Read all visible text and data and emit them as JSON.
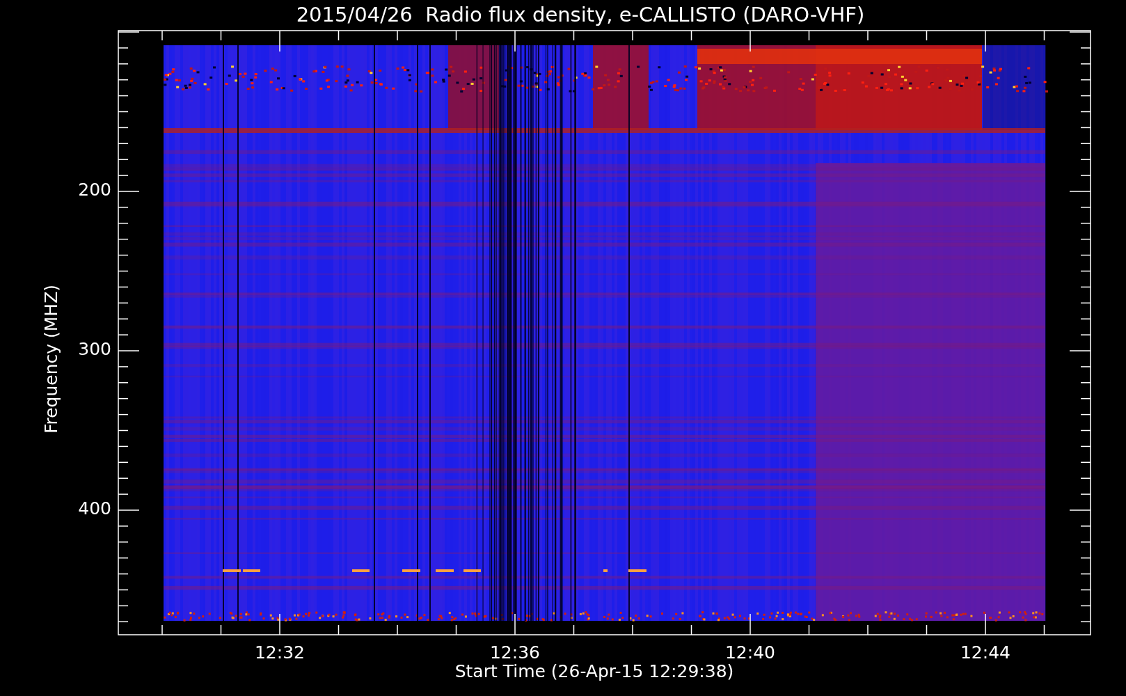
{
  "title": "2015/04/26  Radio flux density, e-CALLISTO (DARO-VHF)",
  "plot": {
    "ylabel": "Frequency (MHZ)",
    "xlabel": "Start Time (26-Apr-15 12:29:38)",
    "y_tick_labels": [
      "200",
      "300",
      "400"
    ],
    "x_tick_labels": [
      "12:32",
      "12:36",
      "12:40",
      "12:44"
    ]
  }
}
